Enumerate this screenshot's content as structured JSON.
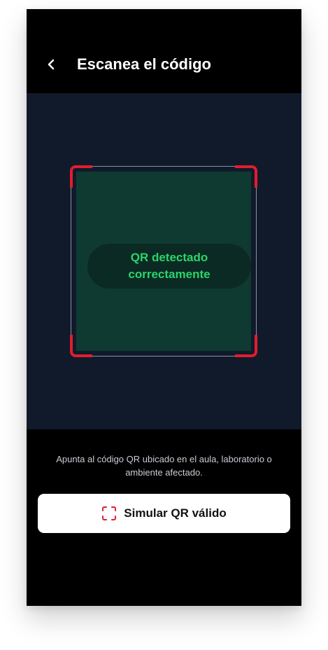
{
  "header": {
    "title": "Escanea el código",
    "back_icon": "chevron-left-icon"
  },
  "scanner": {
    "status_text": "QR detectado correctamente",
    "status_color": "#2bd46a",
    "corner_color": "#e11d2e"
  },
  "instructions": "Apunta al código QR ubicado en el aula, laboratorio o ambiente afectado.",
  "simulate_button": {
    "label": "Simular QR válido",
    "icon": "scan-frame-icon"
  }
}
